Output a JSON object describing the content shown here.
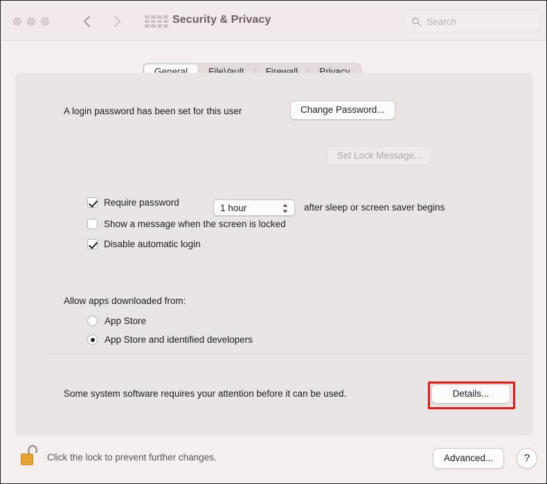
{
  "window": {
    "title": "Security & Privacy",
    "traffic_lights": [
      "close",
      "minimize",
      "zoom"
    ],
    "nav": {
      "back": "back-chevron",
      "forward": "forward-chevron",
      "show_all": "grid-icon"
    },
    "colors": {
      "window_bg": "#f6efef",
      "titlebar_bg": "#f2eaea",
      "panel_bg": "#eae5e5",
      "highlight_red": "#ee1515",
      "lock_gold": "#e8a12c"
    }
  },
  "search": {
    "placeholder": "Search",
    "value": "",
    "icon": "search-icon"
  },
  "tabs": [
    {
      "label": "General",
      "selected": true
    },
    {
      "label": "FileVault",
      "selected": false
    },
    {
      "label": "Firewall",
      "selected": false
    },
    {
      "label": "Privacy",
      "selected": false
    }
  ],
  "general": {
    "password_status": "A login password has been set for this user",
    "change_password_label": "Change Password...",
    "require_password": {
      "label": "Require password",
      "checked": true,
      "interval": "1 hour",
      "suffix": "after sleep or screen saver begins"
    },
    "show_message": {
      "label": "Show a message when the screen is locked",
      "checked": false,
      "button_label": "Set Lock Message...",
      "button_disabled": true
    },
    "disable_auto_login": {
      "label": "Disable automatic login",
      "checked": true
    },
    "allow_apps_heading": "Allow apps downloaded from:",
    "allow_apps_options": [
      {
        "label": "App Store",
        "selected": false
      },
      {
        "label": "App Store and identified developers",
        "selected": true
      }
    ],
    "attention_notice": "Some system software requires your attention before it can be used.",
    "details_label": "Details..."
  },
  "bottom": {
    "lock_icon": "open-padlock-icon",
    "lock_message": "Click the lock to prevent further changes.",
    "advanced_label": "Advanced...",
    "help_label": "?"
  }
}
